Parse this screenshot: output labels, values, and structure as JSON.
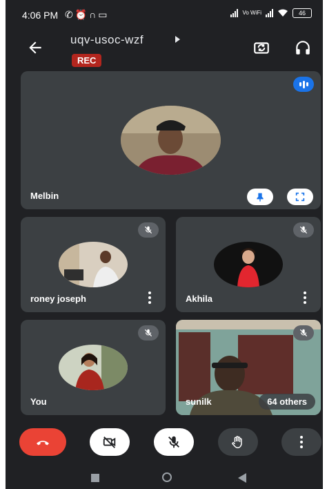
{
  "status_bar": {
    "time": "4:06 PM",
    "left_icons": [
      "no-call-icon",
      "alarm-icon",
      "headset-icon",
      "video-icon"
    ],
    "network_label": "Vo WiFi",
    "battery": "46"
  },
  "header": {
    "meeting_code": "uqv-usoc-wzf",
    "rec_label": "REC"
  },
  "tiles": {
    "main": {
      "name": "Melbin"
    },
    "roney": {
      "name": "roney joseph"
    },
    "akhila": {
      "name": "Akhila"
    },
    "you": {
      "name": "You"
    },
    "sunil": {
      "name": "sunilk",
      "others": "64 others"
    }
  },
  "colors": {
    "background": "#202124",
    "tile": "#3c4043",
    "end_call": "#ea4335",
    "speaking_badge": "#1a73e8",
    "rec": "#b3261e"
  },
  "controls": [
    "end-call",
    "camera-off",
    "mic-off",
    "raise-hand",
    "more-options"
  ]
}
